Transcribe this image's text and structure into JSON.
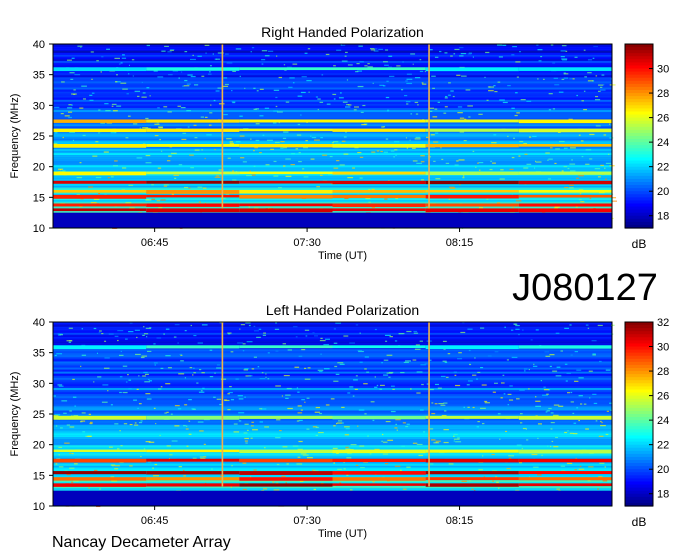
{
  "figure_id": "J080127",
  "footer": "Nancay Decameter Array",
  "colorbar_unit": "dB",
  "chart_data": [
    {
      "type": "heatmap",
      "title": "Right Handed Polarization",
      "xlabel": "Time (UT)",
      "ylabel": "Frequency (MHz)",
      "xlim": [
        "06:15",
        "09:00"
      ],
      "ylim": [
        10,
        40
      ],
      "x_ticks": [
        "06:45",
        "07:30",
        "08:15"
      ],
      "y_ticks": [
        10,
        15,
        20,
        25,
        30,
        35,
        40
      ],
      "colorbar": {
        "min": 17,
        "max": 32,
        "ticks": [
          18,
          20,
          22,
          24,
          26,
          28,
          30
        ],
        "unit": "dB"
      },
      "vertical_lines": [
        "07:05",
        "08:06"
      ],
      "horizontal_features": [
        {
          "freq_mhz": 11.5,
          "db": 17.5
        },
        {
          "freq_mhz": 13.0,
          "db": 31
        },
        {
          "freq_mhz": 13.8,
          "db": 30
        },
        {
          "freq_mhz": 15.2,
          "db": 29
        },
        {
          "freq_mhz": 16.0,
          "db": 27
        },
        {
          "freq_mhz": 17.5,
          "db": 31
        },
        {
          "freq_mhz": 19.0,
          "db": 26
        },
        {
          "freq_mhz": 23.5,
          "db": 27
        },
        {
          "freq_mhz": 26.0,
          "db": 26
        },
        {
          "freq_mhz": 27.5,
          "db": 27
        },
        {
          "freq_mhz": 36.0,
          "db": 23
        }
      ]
    },
    {
      "type": "heatmap",
      "title": "Left Handed Polarization",
      "xlabel": "Time (UT)",
      "ylabel": "Frequency (MHz)",
      "xlim": [
        "06:15",
        "09:00"
      ],
      "ylim": [
        10,
        40
      ],
      "x_ticks": [
        "06:45",
        "07:30",
        "08:15"
      ],
      "y_ticks": [
        10,
        15,
        20,
        25,
        30,
        35,
        40
      ],
      "colorbar": {
        "min": 17,
        "max": 32,
        "ticks": [
          18,
          20,
          22,
          24,
          26,
          28,
          30,
          32
        ],
        "unit": "dB"
      },
      "vertical_lines": [
        "07:05",
        "08:06"
      ],
      "horizontal_features": [
        {
          "freq_mhz": 11.5,
          "db": 17.5
        },
        {
          "freq_mhz": 13.5,
          "db": 31
        },
        {
          "freq_mhz": 14.5,
          "db": 29
        },
        {
          "freq_mhz": 15.5,
          "db": 31
        },
        {
          "freq_mhz": 17.5,
          "db": 30
        },
        {
          "freq_mhz": 19.0,
          "db": 26
        },
        {
          "freq_mhz": 24.5,
          "db": 25
        },
        {
          "freq_mhz": 36.0,
          "db": 23
        }
      ]
    }
  ]
}
